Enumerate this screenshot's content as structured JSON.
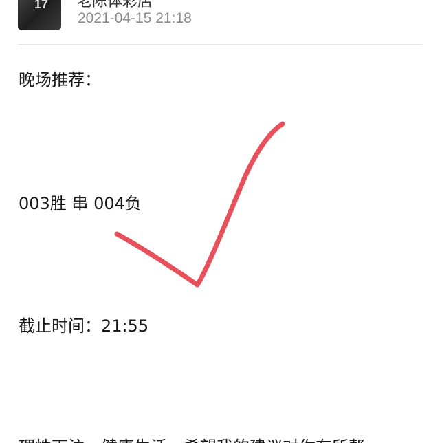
{
  "post": {
    "author": "老陈体彩店",
    "timestamp": "2021-04-15 21:18",
    "avatar_jersey_number": "17"
  },
  "content": {
    "line1": "晚场推荐：",
    "line2": "003胜  串  004负",
    "line3": "截止时间：21:55",
    "line4": "理性下注，健康生活，希望我的建议对你有所帮"
  },
  "colors": {
    "checkmark": "#e8505b",
    "divider": "#e6e6e6",
    "timestamp": "#8a8a8a"
  },
  "icons": {
    "checkmark": "checkmark-icon"
  }
}
